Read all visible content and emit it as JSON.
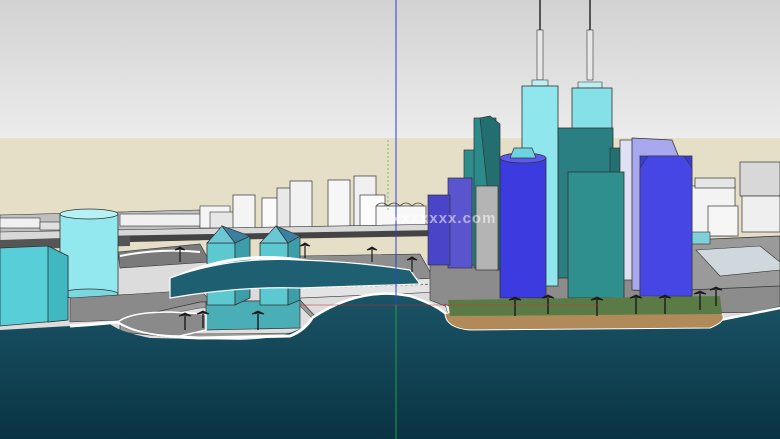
{
  "viewport": {
    "watermark": "xxxxxxx.com",
    "colors": {
      "sky_top": "#dcdcdc",
      "sky_horizon": "#e8e8e8",
      "ground": "#e6dfc8",
      "water": "#0c3a4c",
      "water_highlight": "#1f5f72",
      "plaza": "#8c8c8c",
      "road": "#ffffff",
      "sand": "#b48c5a",
      "lawn": "#5a7a44",
      "building_cyan": "#5ad4dc",
      "building_teal": "#2b8a8a",
      "building_blue": "#3c3cdc",
      "building_lavender": "#a0a0e8",
      "building_white": "#f4f4f4",
      "axis_blue": "#3040c8",
      "axis_green": "#20a040",
      "axis_red": "#c83030"
    },
    "axis_icon": "axes-icon",
    "tree_icon": "palm-tree-icon"
  }
}
